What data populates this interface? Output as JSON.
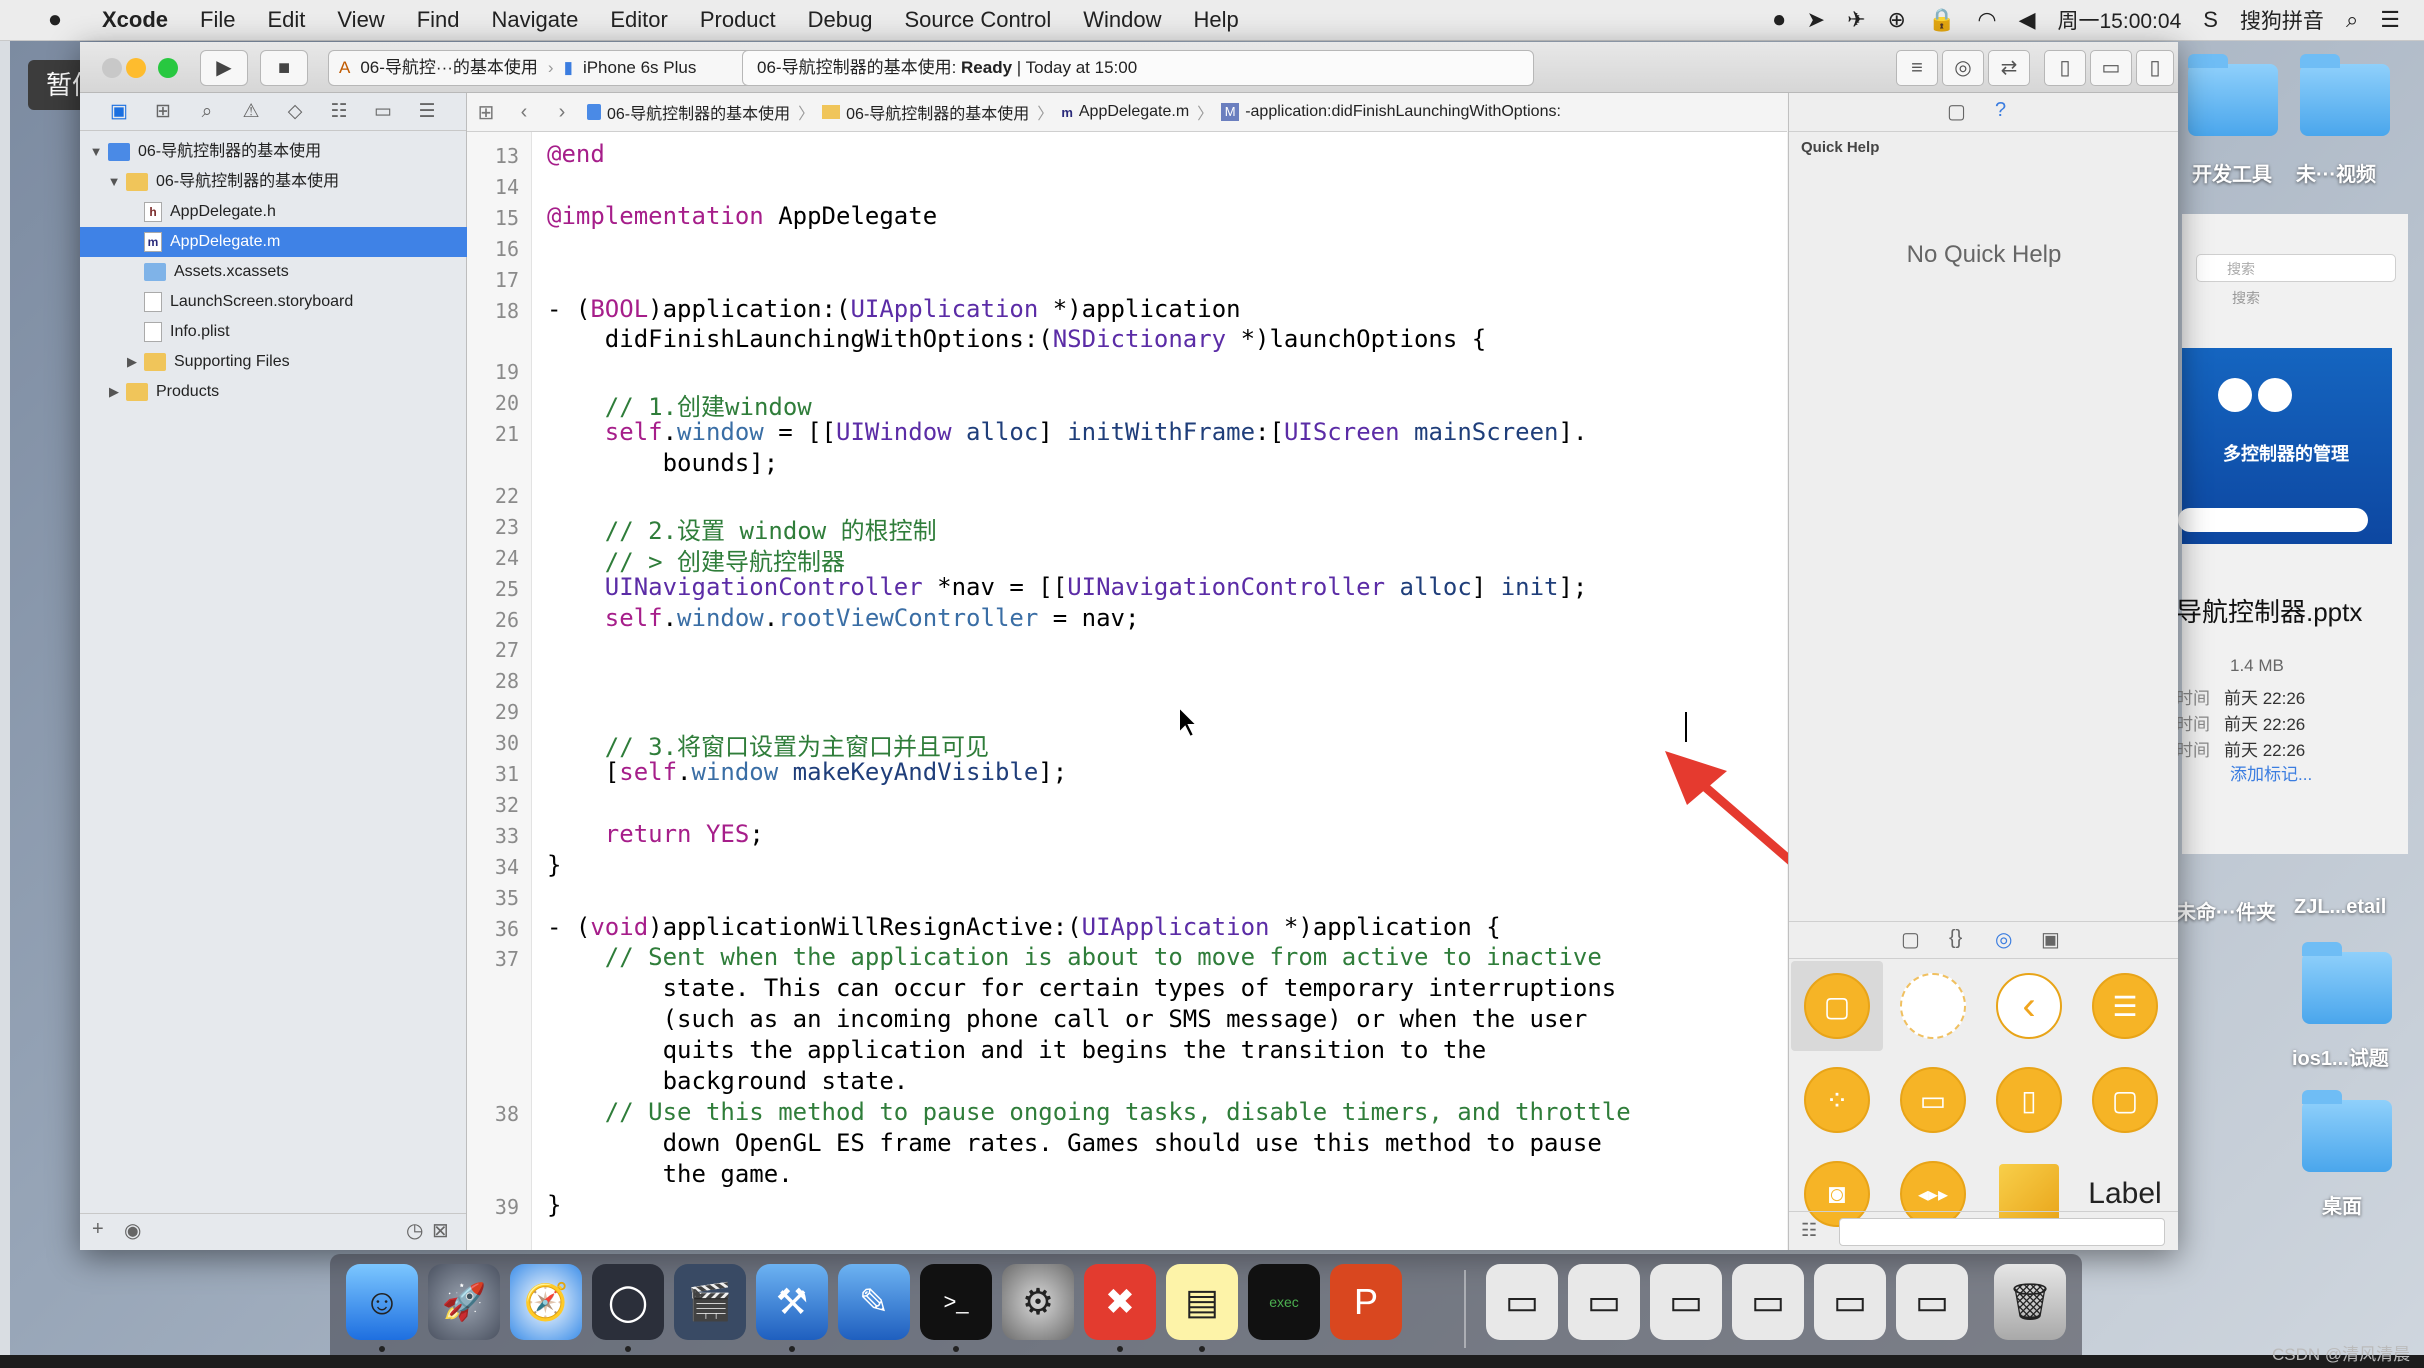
{
  "menubar": {
    "apple": "",
    "items": [
      "Xcode",
      "File",
      "Edit",
      "View",
      "Find",
      "Navigate",
      "Editor",
      "Product",
      "Debug",
      "Source Control",
      "Window",
      "Help"
    ],
    "clock": "周一15:00:04",
    "input_method": "搜狗拼音"
  },
  "overlay": {
    "pause_label": "暂停"
  },
  "toolbar": {
    "scheme_name": "06-导航控···的基本使用",
    "device": "iPhone 6s Plus",
    "activity_project": "06-导航控制器的基本使用:",
    "activity_status": "Ready",
    "activity_time": "Today at 15:00"
  },
  "navigator": {
    "tree": [
      {
        "label": "06-导航控制器的基本使用",
        "kind": "project",
        "disclosure": "▼",
        "level": 0
      },
      {
        "label": "06-导航控制器的基本使用",
        "kind": "folder",
        "disclosure": "▼",
        "level": 1
      },
      {
        "label": "AppDelegate.h",
        "kind": "h",
        "disclosure": "",
        "level": 2
      },
      {
        "label": "AppDelegate.m",
        "kind": "m",
        "disclosure": "",
        "level": 2,
        "selected": true
      },
      {
        "label": "Assets.xcassets",
        "kind": "assets",
        "disclosure": "",
        "level": 2
      },
      {
        "label": "LaunchScreen.storyboard",
        "kind": "story",
        "disclosure": "",
        "level": 2
      },
      {
        "label": "Info.plist",
        "kind": "plist",
        "disclosure": "",
        "level": 2
      },
      {
        "label": "Supporting Files",
        "kind": "folder",
        "disclosure": "▶",
        "level": 2
      },
      {
        "label": "Products",
        "kind": "folder",
        "disclosure": "▶",
        "level": 1
      }
    ]
  },
  "jumpbar": {
    "crumbs": [
      "06-导航控制器的基本使用",
      "06-导航控制器的基本使用",
      "AppDelegate.m",
      "-application:didFinishLaunchingWithOptions:"
    ]
  },
  "editor": {
    "lines": [
      {
        "n": "13",
        "code": "@end"
      },
      {
        "n": "14",
        "code": ""
      },
      {
        "n": "15",
        "code": "@implementation AppDelegate"
      },
      {
        "n": "16",
        "code": ""
      },
      {
        "n": "17",
        "code": ""
      },
      {
        "n": "18",
        "code": "- (BOOL)application:(UIApplication *)application"
      },
      {
        "n": "",
        "code": "    didFinishLaunchingWithOptions:(NSDictionary *)launchOptions {"
      },
      {
        "n": "19",
        "code": ""
      },
      {
        "n": "20",
        "code": "    // 1.创建window"
      },
      {
        "n": "21",
        "code": "    self.window = [[UIWindow alloc] initWithFrame:[UIScreen mainScreen]."
      },
      {
        "n": "",
        "code": "        bounds];"
      },
      {
        "n": "22",
        "code": ""
      },
      {
        "n": "23",
        "code": "    // 2.设置 window 的根控制"
      },
      {
        "n": "24",
        "code": "    // > 创建导航控制器"
      },
      {
        "n": "25",
        "code": "    UINavigationController *nav = [[UINavigationController alloc] init];"
      },
      {
        "n": "26",
        "code": "    self.window.rootViewController = nav;"
      },
      {
        "n": "27",
        "code": ""
      },
      {
        "n": "28",
        "code": ""
      },
      {
        "n": "29",
        "code": ""
      },
      {
        "n": "30",
        "code": "    // 3.将窗口设置为主窗口并且可见"
      },
      {
        "n": "31",
        "code": "    [self.window makeKeyAndVisible];"
      },
      {
        "n": "32",
        "code": ""
      },
      {
        "n": "33",
        "code": "    return YES;"
      },
      {
        "n": "34",
        "code": "}"
      },
      {
        "n": "35",
        "code": ""
      },
      {
        "n": "36",
        "code": "- (void)applicationWillResignActive:(UIApplication *)application {"
      },
      {
        "n": "37",
        "code": "    // Sent when the application is about to move from active to inactive"
      },
      {
        "n": "",
        "code": "        state. This can occur for certain types of temporary interruptions"
      },
      {
        "n": "",
        "code": "        (such as an incoming phone call or SMS message) or when the user"
      },
      {
        "n": "",
        "code": "        quits the application and it begins the transition to the"
      },
      {
        "n": "",
        "code": "        background state."
      },
      {
        "n": "38",
        "code": "    // Use this method to pause ongoing tasks, disable timers, and throttle"
      },
      {
        "n": "",
        "code": "        down OpenGL ES frame rates. Games should use this method to pause"
      },
      {
        "n": "",
        "code": "        the game."
      },
      {
        "n": "39",
        "code": "}"
      }
    ]
  },
  "inspector": {
    "quick_help_title": "Quick Help",
    "no_quick_help": "No Quick Help",
    "library_label": "Label"
  },
  "desktop": {
    "dev_tools": "开发工具",
    "unnamed_video": "未···视频",
    "search_placeholder": "搜索",
    "search_caption": "搜索",
    "pptx_thumb_title": "多控制器的管理",
    "pptx_name": "导航控制器.pptx",
    "pptx_size": "1.4 MB",
    "meta": [
      {
        "k": "时间",
        "v": "前天 22:26"
      },
      {
        "k": "时间",
        "v": "前天 22:26"
      },
      {
        "k": "时间",
        "v": "前天 22:26"
      }
    ],
    "add_tag": "添加标记...",
    "folder_unnamed": "未命···件夹",
    "folder_zjl": "ZJL...etail",
    "folder_ios": "ios1...试题",
    "folder_desktop": "桌面"
  },
  "watermark": "CSDN @清风清晨",
  "colors": {
    "keyword": "#a61e8a",
    "type": "#5b2ca6",
    "property": "#3a6ea5",
    "comment": "#2f7d3a",
    "selection": "#3f82e6",
    "annotation_arrow": "#e53a2f"
  }
}
